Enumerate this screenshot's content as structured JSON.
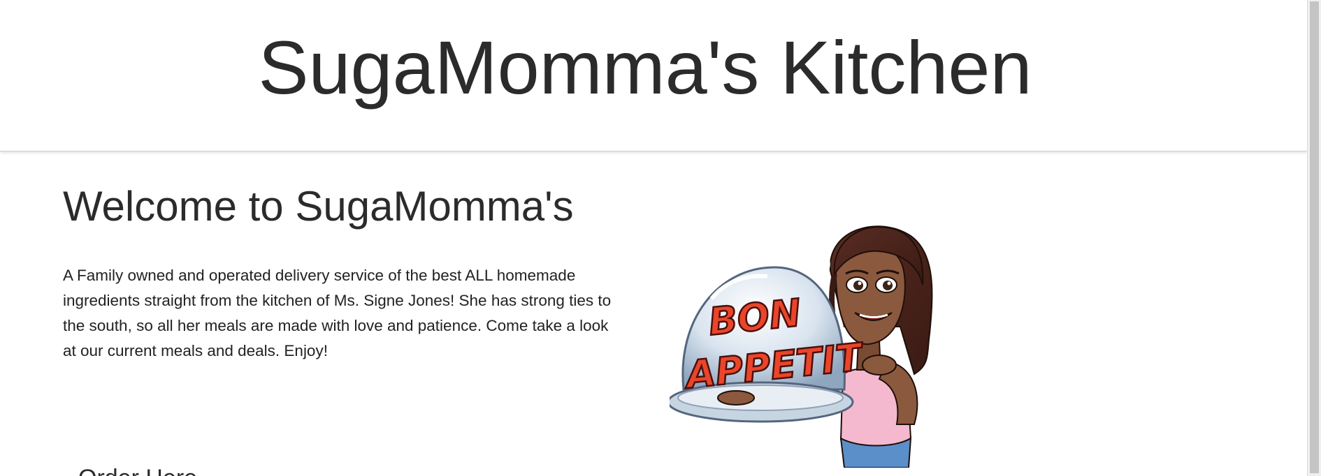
{
  "header": {
    "site_title": "SugaMomma's Kitchen"
  },
  "main": {
    "welcome_heading": "Welcome to SugaMomma's",
    "intro_text": "A Family owned and operated delivery service of the best ALL homemade ingredients straight from the kitchen of Ms. Signe Jones! She has strong ties to the south, so all her meals are made with love and patience. Come take a look at our current meals and deals. Enjoy!",
    "next_heading": "Order Here"
  },
  "mascot": {
    "icon": "bitmoji-bon-appetit-image",
    "lettering": [
      "BON",
      "APPETIT"
    ]
  },
  "colors": {
    "header_bg": "#ffffff",
    "text": "#2b2b2b",
    "lettering": "#e8452a",
    "shirt": "#f4b8cf"
  }
}
